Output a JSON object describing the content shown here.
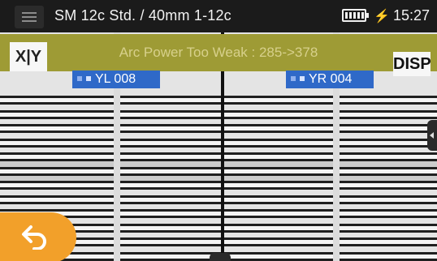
{
  "titlebar": {
    "title": "SM 12c Std. / 40mm 1-12c",
    "time": "15:27",
    "icons": {
      "menu": "hamburger-menu-icon",
      "battery": "battery-full-icon",
      "charging": "charging-bolt-icon"
    }
  },
  "alert": {
    "message": "Arc Power Too Weak : 285->378"
  },
  "buttons": {
    "xy_label": "X|Y",
    "disp_label": "DISP"
  },
  "labels": {
    "left": "YL  008",
    "right": "YR  004"
  },
  "colors": {
    "alert": "#9e9b35",
    "label": "#2f69c8",
    "back_button": "#f2a02a"
  }
}
